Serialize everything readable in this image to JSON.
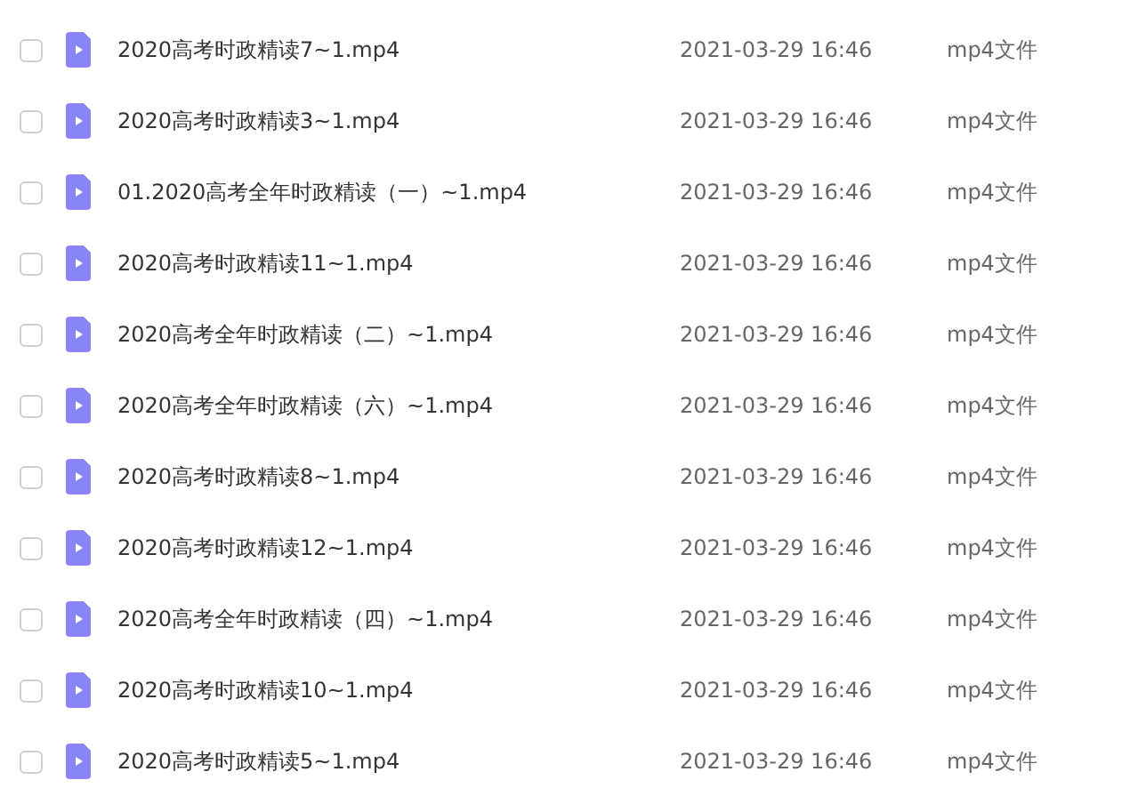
{
  "files": [
    {
      "name": "2020高考时政精读7~1.mp4",
      "modified": "2021-03-29 16:46",
      "type": "mp4文件",
      "checked": false
    },
    {
      "name": "2020高考时政精读3~1.mp4",
      "modified": "2021-03-29 16:46",
      "type": "mp4文件",
      "checked": false
    },
    {
      "name": "01.2020高考全年时政精读（一）~1.mp4",
      "modified": "2021-03-29 16:46",
      "type": "mp4文件",
      "checked": false
    },
    {
      "name": "2020高考时政精读11~1.mp4",
      "modified": "2021-03-29 16:46",
      "type": "mp4文件",
      "checked": false
    },
    {
      "name": "2020高考全年时政精读（二）~1.mp4",
      "modified": "2021-03-29 16:46",
      "type": "mp4文件",
      "checked": false
    },
    {
      "name": "2020高考全年时政精读（六）~1.mp4",
      "modified": "2021-03-29 16:46",
      "type": "mp4文件",
      "checked": false
    },
    {
      "name": "2020高考时政精读8~1.mp4",
      "modified": "2021-03-29 16:46",
      "type": "mp4文件",
      "checked": false
    },
    {
      "name": "2020高考时政精读12~1.mp4",
      "modified": "2021-03-29 16:46",
      "type": "mp4文件",
      "checked": false
    },
    {
      "name": "2020高考全年时政精读（四）~1.mp4",
      "modified": "2021-03-29 16:46",
      "type": "mp4文件",
      "checked": false
    },
    {
      "name": "2020高考时政精读10~1.mp4",
      "modified": "2021-03-29 16:46",
      "type": "mp4文件",
      "checked": false
    },
    {
      "name": "2020高考时政精读5~1.mp4",
      "modified": "2021-03-29 16:46",
      "type": "mp4文件",
      "checked": false
    }
  ]
}
